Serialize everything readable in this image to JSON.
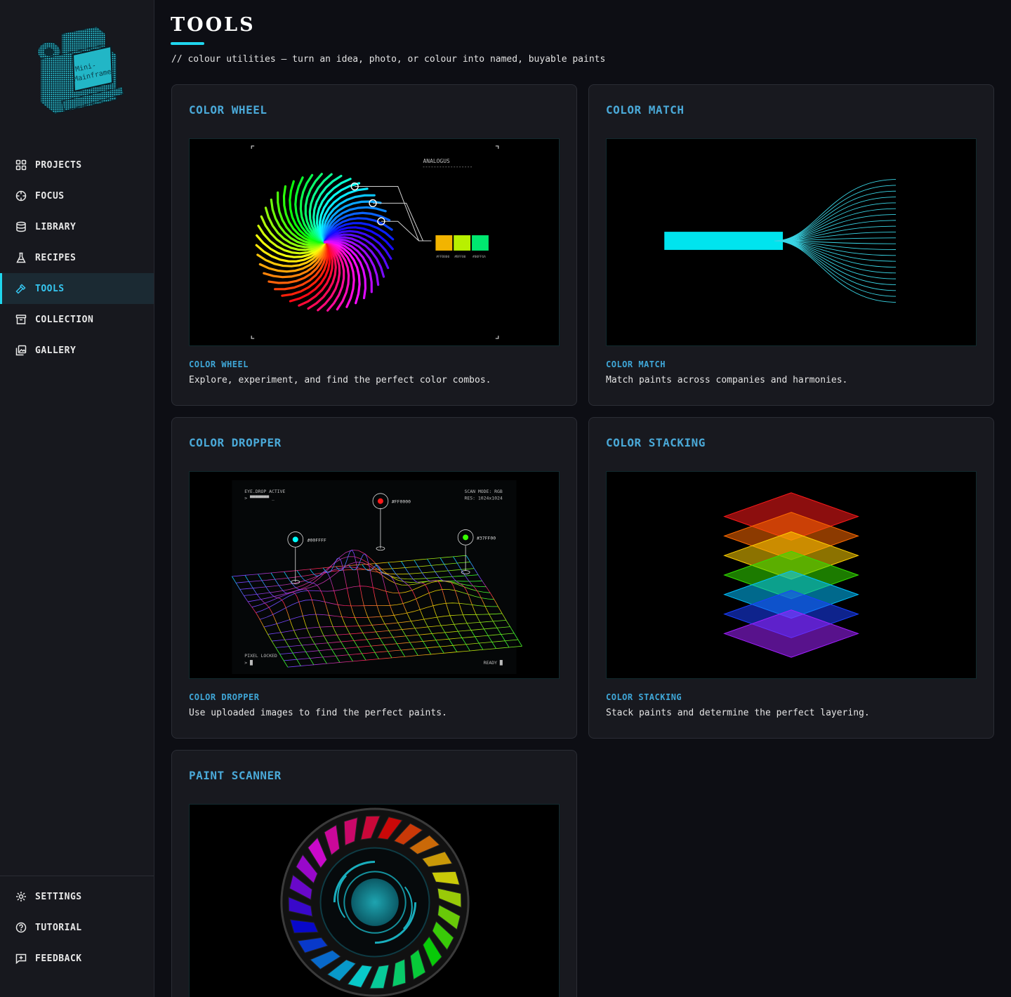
{
  "sidebar": {
    "logo_text": [
      "Mini-",
      "Mainframe"
    ],
    "nav": [
      {
        "label": "PROJECTS",
        "icon": "grid-icon"
      },
      {
        "label": "FOCUS",
        "icon": "crosshair-icon"
      },
      {
        "label": "LIBRARY",
        "icon": "database-icon"
      },
      {
        "label": "RECIPES",
        "icon": "flask-icon"
      },
      {
        "label": "TOOLS",
        "icon": "hammer-icon",
        "active": true
      },
      {
        "label": "COLLECTION",
        "icon": "archive-icon"
      },
      {
        "label": "GALLERY",
        "icon": "images-icon"
      }
    ],
    "bottom": [
      {
        "label": "SETTINGS",
        "icon": "gear-icon"
      },
      {
        "label": "TUTORIAL",
        "icon": "help-circle-icon"
      },
      {
        "label": "FEEDBACK",
        "icon": "message-plus-icon"
      }
    ]
  },
  "header": {
    "title": "TOOLS",
    "subtitle": "// colour utilities — turn an idea, photo, or colour into named, buyable paints"
  },
  "cards": [
    {
      "title": "COLOR WHEEL",
      "subtitle": "COLOR WHEEL",
      "description": "Explore, experiment, and find the perfect color combos.",
      "art": {
        "label": "ANALOGUS",
        "swatches": [
          "#FFB800",
          "#BFF00",
          "#00FF6A"
        ],
        "swatch_colors": [
          "#f2b400",
          "#b8f000",
          "#00e870"
        ]
      }
    },
    {
      "title": "COLOR MATCH",
      "subtitle": "COLOR MATCH",
      "description": "Match paints across companies and harmonies."
    },
    {
      "title": "COLOR DROPPER",
      "subtitle": "COLOR DROPPER",
      "description": "Use uploaded images to find the perfect paints.",
      "art": {
        "top_left": "EYE.DROP ACTIVE",
        "top_left_sub": "> ▀▀▀▀▀▀▀ _",
        "top_right": "SCAN MODE: RGB",
        "top_right_sub": "RES: 1024x1024",
        "pin_red": "#FF0000",
        "pin_cyan": "#00FFFF",
        "pin_green": "#37FF00",
        "bottom_left": "PIXEL LOCKED",
        "bottom_left_sub": "> █",
        "bottom_right": "READY █"
      }
    },
    {
      "title": "COLOR STACKING",
      "subtitle": "COLOR STACKING",
      "description": "Stack paints and determine the perfect layering."
    },
    {
      "title": "PAINT SCANNER",
      "subtitle": "",
      "description": ""
    }
  ],
  "colors": {
    "accent": "#1fd6ee",
    "card_title": "#4aa9d8",
    "bg": "#0d0e14",
    "sidebar_bg": "#17181e"
  }
}
